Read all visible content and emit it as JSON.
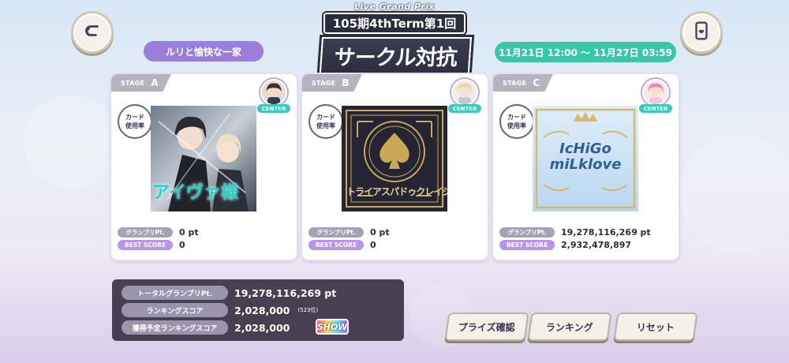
{
  "header": {
    "event_top": "Live Grand Prix",
    "event_term": "105期4thTerm第1回",
    "event_title": "サークル対抗戦",
    "team_name": "ルリと愉快な一家",
    "period": "11月21日 12:00 〜 11月27日 03:59",
    "back_icon": "back-arrow-icon",
    "phone_icon": "phone-icon"
  },
  "stages": [
    {
      "stage_label": "STAGE",
      "letter": "A",
      "center_label": "CENTER",
      "usage_line1": "カード",
      "usage_line2": "使用率",
      "jacket_text": "アイヴァ様",
      "gp_label": "グランプリPt.",
      "gp_value": "0 pt",
      "bs_label": "BEST SCORE",
      "bs_value": "0"
    },
    {
      "stage_label": "STAGE",
      "letter": "B",
      "center_label": "CENTER",
      "usage_line1": "カード",
      "usage_line2": "使用率",
      "jacket_text": "トライアスパドゥクレイジー",
      "gp_label": "グランプリPt.",
      "gp_value": "0 pt",
      "bs_label": "BEST SCORE",
      "bs_value": "0"
    },
    {
      "stage_label": "STAGE",
      "letter": "C",
      "center_label": "CENTER",
      "usage_line1": "カード",
      "usage_line2": "使用率",
      "jacket_line1": "IcHiGo",
      "jacket_line2": "miLklove",
      "gp_label": "グランプリPt.",
      "gp_value": "19,278,116,269 pt",
      "bs_label": "BEST SCORE",
      "bs_value": "2,932,478,897"
    }
  ],
  "summary": {
    "total_label": "トータルグランプリPt.",
    "total_value": "19,278,116,269 pt",
    "ranking_label": "ランキングスコア",
    "ranking_value": "2,028,000",
    "ranking_place": "(523位)",
    "expected_label": "獲得予定ランキングスコア",
    "expected_value": "2,028,000",
    "show_badge": "SHOW"
  },
  "buttons": {
    "prize": "プライズ確認",
    "ranking": "ランキング",
    "reset": "リセット"
  },
  "colors": {
    "team_pill": "#9b7ed8",
    "date_pill": "#38c8a8",
    "center_badge": "#3ec7c0",
    "best_score_badge": "#b995ea"
  }
}
